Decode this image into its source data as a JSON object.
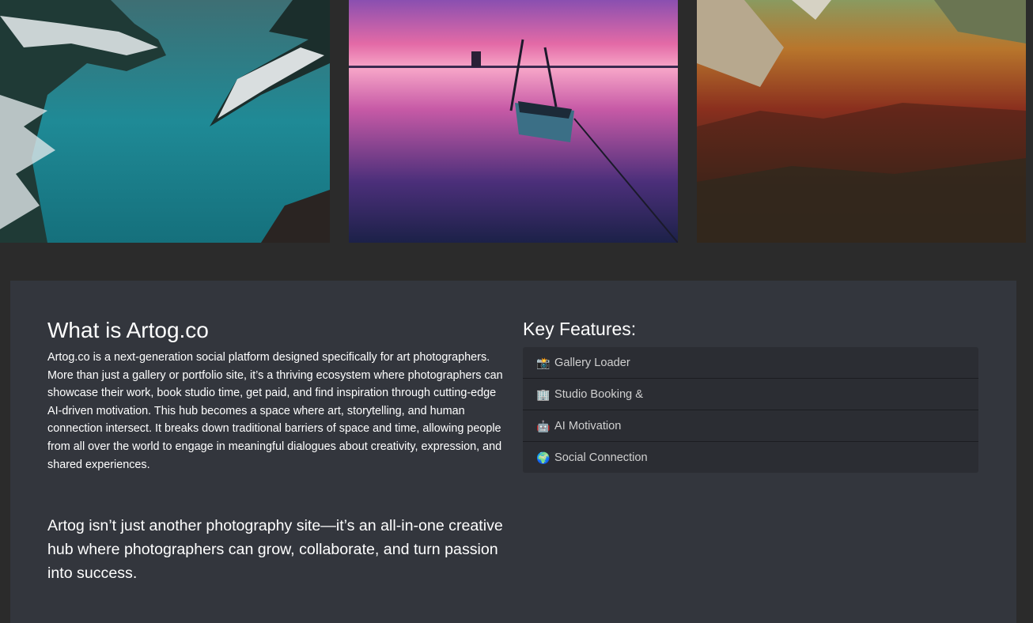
{
  "gallery": {
    "photos": [
      {
        "icon": "frozen-lake-photo"
      },
      {
        "icon": "sunset-boat-photo"
      },
      {
        "icon": "autumn-forest-photo"
      }
    ]
  },
  "about": {
    "title": "What is Artog.co",
    "body": "Artog.co is a next-generation social platform designed specifically for art photographers. More than just a gallery or portfolio site, it’s a thriving ecosystem where photographers can showcase their work, book studio time, get paid, and find inspiration through cutting-edge AI-driven motivation. This hub becomes a space where art, storytelling, and human connection intersect. It breaks down traditional barriers of space and time, allowing people from all over the world to engage in meaningful dialogues about creativity, expression, and shared experiences.",
    "tagline": "Artog isn’t just another photography site—it’s an all-in-one creative hub where photographers can grow, collaborate, and turn passion into success."
  },
  "features": {
    "title": "Key Features:",
    "items": [
      {
        "emoji": "📸",
        "icon": "camera-icon",
        "label": "Gallery Loader"
      },
      {
        "emoji": "🏢",
        "icon": "building-icon",
        "label": "Studio Booking &"
      },
      {
        "emoji": "🤖",
        "icon": "robot-icon",
        "label": "AI Motivation"
      },
      {
        "emoji": "🌍",
        "icon": "globe-icon",
        "label": "Social Connection"
      }
    ]
  },
  "colors": {
    "page_background": "#2b2b2b",
    "panel_background": "#33363d",
    "feature_list_background": "#2b2d33"
  }
}
